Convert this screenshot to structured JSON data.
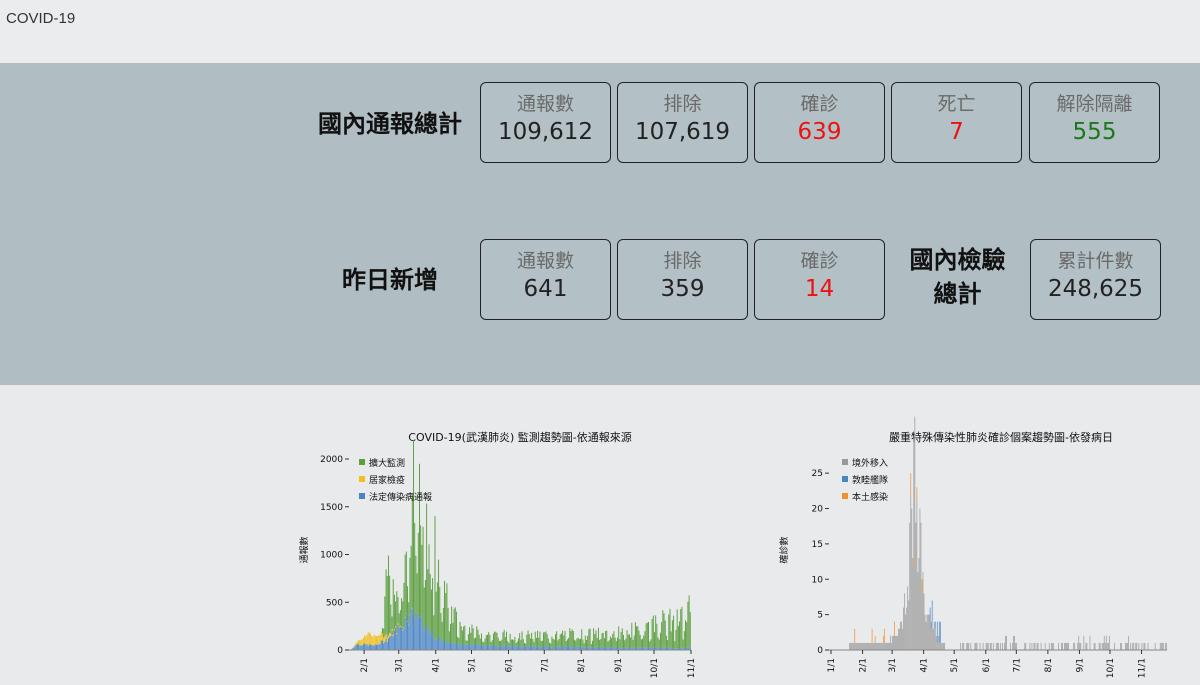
{
  "header": {
    "title": "COVID-19"
  },
  "domestic_total": {
    "label": "國內通報總計",
    "cards": [
      {
        "label": "通報數",
        "value": "109,612",
        "color": "default"
      },
      {
        "label": "排除",
        "value": "107,619",
        "color": "default"
      },
      {
        "label": "確診",
        "value": "639",
        "color": "red"
      },
      {
        "label": "死亡",
        "value": "7",
        "color": "red"
      },
      {
        "label": "解除隔離",
        "value": "555",
        "color": "green"
      }
    ]
  },
  "yesterday": {
    "label": "昨日新增",
    "cards": [
      {
        "label": "通報數",
        "value": "641",
        "color": "default"
      },
      {
        "label": "排除",
        "value": "359",
        "color": "default"
      },
      {
        "label": "確診",
        "value": "14",
        "color": "red"
      }
    ]
  },
  "tests": {
    "label_line1": "國內檢驗",
    "label_line2": "總計",
    "card": {
      "label": "累計件數",
      "value": "248,625"
    }
  },
  "colors": {
    "red": "#ee1111",
    "green": "#1a7a1a",
    "panel_bg": "#b0bec4"
  },
  "chart_data": [
    {
      "type": "bar",
      "stacked": true,
      "title": "COVID-19(武漢肺炎) 監測趨勢圖-依通報來源",
      "ylabel": "通報數",
      "ylim": [
        0,
        2000
      ],
      "yticks": [
        "0",
        "500",
        "1000",
        "1500",
        "2000"
      ],
      "xticks": [
        "2/1",
        "3/1",
        "4/1",
        "5/1",
        "6/1",
        "7/1",
        "8/1",
        "9/1",
        "10/1",
        "11/1"
      ],
      "x_start": "2020-01-21",
      "legend_position": "top-left",
      "series": [
        {
          "name": "法定傳染病通報",
          "color": "#4a86c5",
          "anchors": [
            [
              0,
              10
            ],
            [
              5,
              70
            ],
            [
              10,
              60
            ],
            [
              20,
              50
            ],
            [
              30,
              120
            ],
            [
              40,
              250
            ],
            [
              50,
              380
            ],
            [
              60,
              300
            ],
            [
              70,
              150
            ],
            [
              80,
              80
            ],
            [
              95,
              60
            ],
            [
              110,
              55
            ],
            [
              130,
              45
            ],
            [
              150,
              40
            ],
            [
              170,
              35
            ],
            [
              190,
              35
            ],
            [
              210,
              30
            ],
            [
              230,
              25
            ],
            [
              250,
              25
            ],
            [
              270,
              20
            ],
            [
              284,
              20
            ]
          ]
        },
        {
          "name": "居家檢疫",
          "color": "#f0c020",
          "anchors": [
            [
              0,
              0
            ],
            [
              5,
              30
            ],
            [
              15,
              130
            ],
            [
              25,
              80
            ],
            [
              35,
              20
            ],
            [
              45,
              5
            ],
            [
              60,
              0
            ],
            [
              284,
              0
            ]
          ]
        },
        {
          "name": "擴大監測",
          "color": "#5a9e3e",
          "anchors": [
            [
              0,
              0
            ],
            [
              25,
              0
            ],
            [
              30,
              600
            ],
            [
              40,
              380
            ],
            [
              50,
              700
            ],
            [
              58,
              1100
            ],
            [
              65,
              850
            ],
            [
              72,
              600
            ],
            [
              80,
              450
            ],
            [
              90,
              200
            ],
            [
              110,
              120
            ],
            [
              140,
              110
            ],
            [
              170,
              130
            ],
            [
              200,
              140
            ],
            [
              220,
              150
            ],
            [
              240,
              200
            ],
            [
              260,
              280
            ],
            [
              275,
              300
            ],
            [
              282,
              350
            ],
            [
              284,
              550
            ]
          ]
        }
      ]
    },
    {
      "type": "bar",
      "stacked": true,
      "title": "嚴重特殊傳染性肺炎確診個案趨勢圖-依發病日",
      "ylabel": "確診數",
      "ylim": [
        0,
        27
      ],
      "yticks": [
        "0",
        "5",
        "10",
        "15",
        "20",
        "25"
      ],
      "xticks": [
        "1/1",
        "2/1",
        "3/1",
        "4/1",
        "5/1",
        "6/1",
        "7/1",
        "8/1",
        "9/1",
        "10/1",
        "11/1"
      ],
      "x_start": "2020-01-01",
      "legend_position": "top-left",
      "series": [
        {
          "name": "境外移入",
          "color": "#999999"
        },
        {
          "name": "敦睦艦隊",
          "color": "#4a86c5"
        },
        {
          "name": "本土感染",
          "color": "#f0912e"
        }
      ]
    }
  ]
}
